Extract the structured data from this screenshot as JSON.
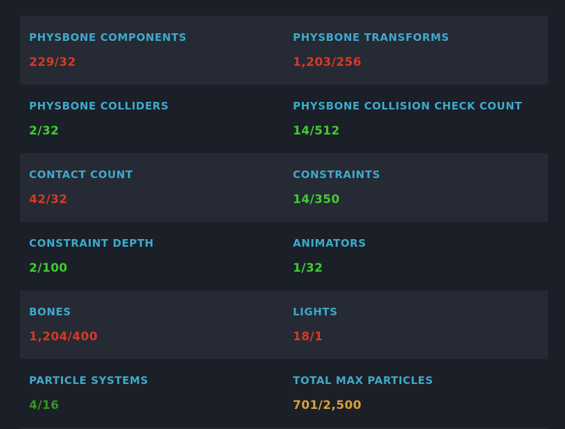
{
  "colors": {
    "label": "#3fa9c9",
    "over": "#d63a23",
    "ok": "#3fcc2f",
    "ok_dim": "#2e9a1f",
    "warn": "#d9a13a"
  },
  "rows": [
    {
      "left": {
        "label": "PHYSBONE COMPONENTS",
        "value": "229/32",
        "status": "over"
      },
      "right": {
        "label": "PHYSBONE TRANSFORMS",
        "value": "1,203/256",
        "status": "over"
      }
    },
    {
      "left": {
        "label": "PHYSBONE COLLIDERS",
        "value": "2/32",
        "status": "ok"
      },
      "right": {
        "label": "PHYSBONE COLLISION CHECK COUNT",
        "value": "14/512",
        "status": "ok"
      }
    },
    {
      "left": {
        "label": "CONTACT COUNT",
        "value": "42/32",
        "status": "over"
      },
      "right": {
        "label": "CONSTRAINTS",
        "value": "14/350",
        "status": "ok"
      }
    },
    {
      "left": {
        "label": "CONSTRAINT DEPTH",
        "value": "2/100",
        "status": "ok"
      },
      "right": {
        "label": "ANIMATORS",
        "value": "1/32",
        "status": "ok"
      }
    },
    {
      "left": {
        "label": "BONES",
        "value": "1,204/400",
        "status": "over"
      },
      "right": {
        "label": "LIGHTS",
        "value": "18/1",
        "status": "over"
      }
    },
    {
      "left": {
        "label": "PARTICLE SYSTEMS",
        "value": "4/16",
        "status": "ok_dim"
      },
      "right": {
        "label": "TOTAL MAX PARTICLES",
        "value": "701/2,500",
        "status": "warn"
      }
    }
  ]
}
